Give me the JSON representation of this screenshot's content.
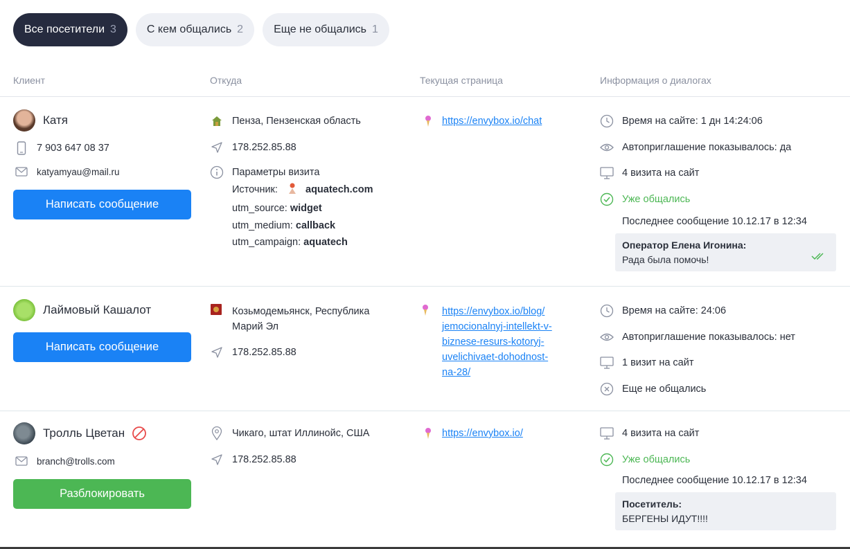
{
  "tabs": [
    {
      "label": "Все посетители",
      "count": "3"
    },
    {
      "label": "С кем общались",
      "count": "2"
    },
    {
      "label": "Еще не общались",
      "count": "1"
    }
  ],
  "columns": {
    "client": "Клиент",
    "from": "Откуда",
    "page": "Текущая страница",
    "info": "Информация о диалогах"
  },
  "visitors": [
    {
      "name": "Катя",
      "phone": "7 903 647 08 37",
      "email": "katyamyau@mail.ru",
      "action": "Написать сообщение",
      "location": "Пенза, Пензенская область",
      "ip": "178.252.85.88",
      "params_title": "Параметры визита",
      "source_label": "Источник:",
      "source_value": "aquatech.com",
      "utm_source_label": "utm_source:",
      "utm_source_value": "widget",
      "utm_medium_label": "utm_medium:",
      "utm_medium_value": "callback",
      "utm_campaign_label": "utm_campaign:",
      "utm_campaign_value": "aquatech",
      "page_url": "https://envybox.io/chat",
      "time_on_site": "Время на сайте: 1 дн 14:24:06",
      "auto_invite": "Автоприглашение показывалось: да",
      "visits": "4 визита на сайт",
      "status": "Уже общались",
      "last_message": "Последнее сообщение 10.12.17 в 12:34",
      "message_author": "Оператор Елена Игонина:",
      "message_text": "Рада была помочь!"
    },
    {
      "name": "Лаймовый Кашалот",
      "action": "Написать сообщение",
      "location_line1": "Козьмодемьянск, Республика",
      "location_line2": "Марий Эл",
      "ip": "178.252.85.88",
      "page_url_lines": [
        "https://envybox.io/blog/",
        "jemocionalnyj-intellekt-v-",
        "biznese-resurs-kotoryj-",
        "uvelichivaet-dohodnost-",
        "na-28/"
      ],
      "time_on_site": "Время на сайте: 24:06",
      "auto_invite": "Автоприглашение показывалось: нет",
      "visits": "1 визит на сайт",
      "status": "Еще не общались"
    },
    {
      "name": "Тролль Цветан",
      "email": "branch@trolls.com",
      "action": "Разблокировать",
      "location": "Чикаго, штат Иллинойс, США",
      "ip": "178.252.85.88",
      "page_url": "https://envybox.io/",
      "visits": "4 визита на сайт",
      "status": "Уже общались",
      "last_message": "Последнее сообщение 10.12.17 в 12:34",
      "message_author": "Посетитель:",
      "message_text": "БЕРГЕНЫ ИДУТ!!!!"
    }
  ],
  "colors": {
    "accent": "#1a82f5",
    "success": "#4cb754",
    "active_tab": "#262b3f",
    "blocked": "#e84a4a"
  },
  "icons": [
    "phone-icon",
    "mail-icon",
    "house-icon",
    "send-icon",
    "info-icon",
    "clock-icon",
    "eye-icon",
    "monitor-icon",
    "check-circle-icon",
    "x-circle-icon",
    "pin-icon",
    "pin-flag-icon",
    "blocked-icon",
    "double-check-icon"
  ]
}
